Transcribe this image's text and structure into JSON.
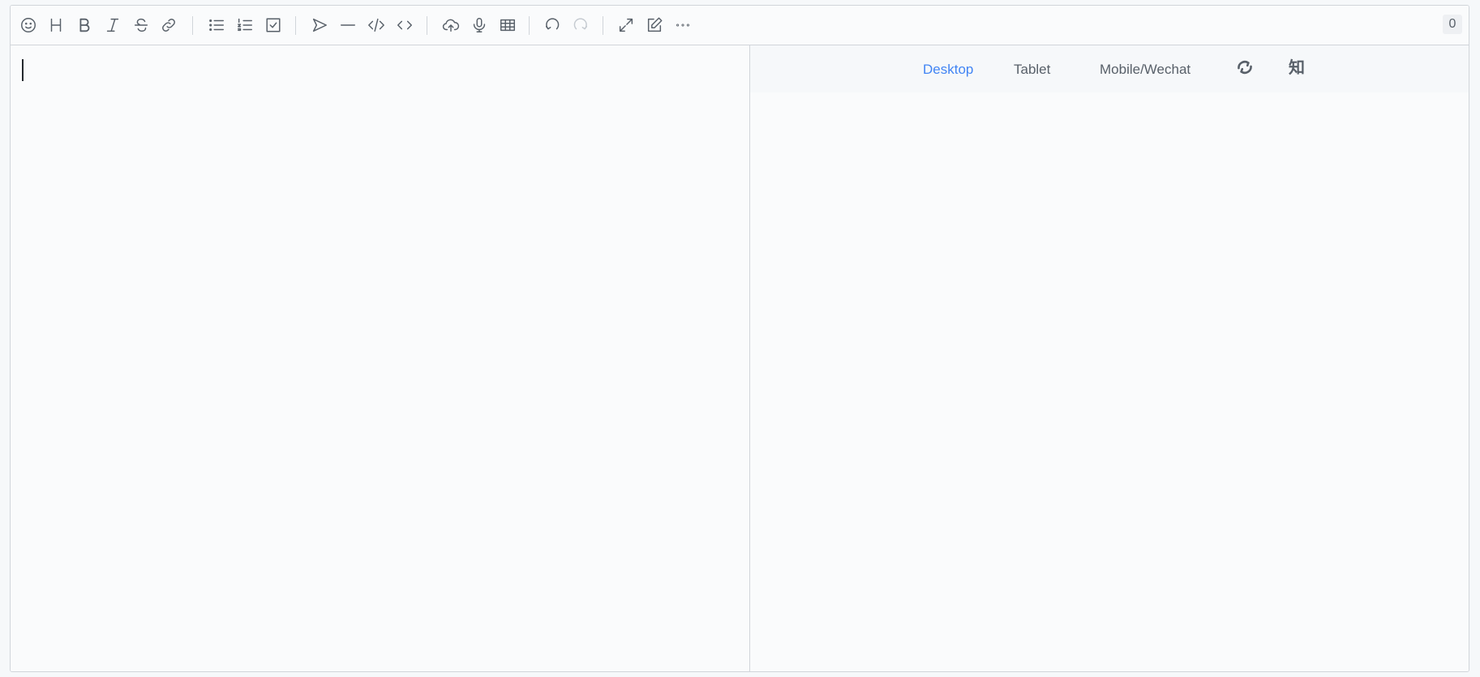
{
  "toolbar": {
    "buttons": [
      {
        "name": "emoji-icon"
      },
      {
        "name": "header-icon"
      },
      {
        "name": "bold-icon"
      },
      {
        "name": "italic-icon"
      },
      {
        "name": "strikethrough-icon"
      },
      {
        "name": "link-icon"
      },
      {
        "name": "unordered-list-icon"
      },
      {
        "name": "ordered-list-icon"
      },
      {
        "name": "checklist-icon"
      },
      {
        "name": "quote-icon"
      },
      {
        "name": "horizontal-line-icon"
      },
      {
        "name": "code-block-icon"
      },
      {
        "name": "inline-code-icon"
      },
      {
        "name": "upload-icon"
      },
      {
        "name": "record-icon"
      },
      {
        "name": "table-icon"
      },
      {
        "name": "undo-icon"
      },
      {
        "name": "redo-icon",
        "disabled": true
      },
      {
        "name": "fullscreen-icon"
      },
      {
        "name": "edit-mode-icon"
      },
      {
        "name": "more-icon"
      }
    ],
    "word_count": "0"
  },
  "editor": {
    "content": ""
  },
  "preview": {
    "tabs": [
      {
        "label": "Desktop",
        "active": true
      },
      {
        "label": "Tablet",
        "active": false
      },
      {
        "label": "Mobile/Wechat",
        "active": false
      }
    ],
    "extra_icons": [
      "refresh-icon"
    ],
    "zhihu_label": "知"
  },
  "colors": {
    "accent": "#4285f4",
    "icon": "#586069",
    "border": "#d1d5da",
    "background": "#fafbfc"
  }
}
